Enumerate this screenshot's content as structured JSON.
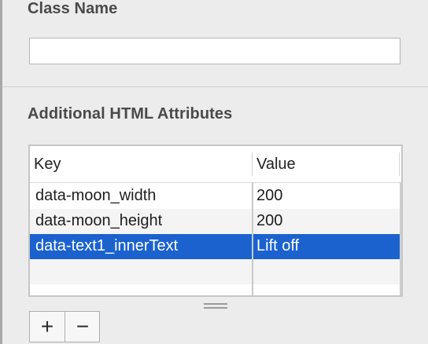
{
  "class_name_section": {
    "title": "Class Name",
    "input_value": ""
  },
  "attributes_section": {
    "title": "Additional HTML Attributes",
    "columns": {
      "key": "Key",
      "value": "Value"
    },
    "rows": [
      {
        "key": "data-moon_width",
        "value": "200",
        "selected": false
      },
      {
        "key": "data-moon_height",
        "value": "200",
        "selected": false
      },
      {
        "key": "data-text1_innerText",
        "value": "Lift off",
        "selected": true
      }
    ]
  },
  "controls": {
    "add_symbol": "+",
    "remove_symbol": "−"
  },
  "colors": {
    "selection": "#1b62cf",
    "background": "#ececec"
  }
}
